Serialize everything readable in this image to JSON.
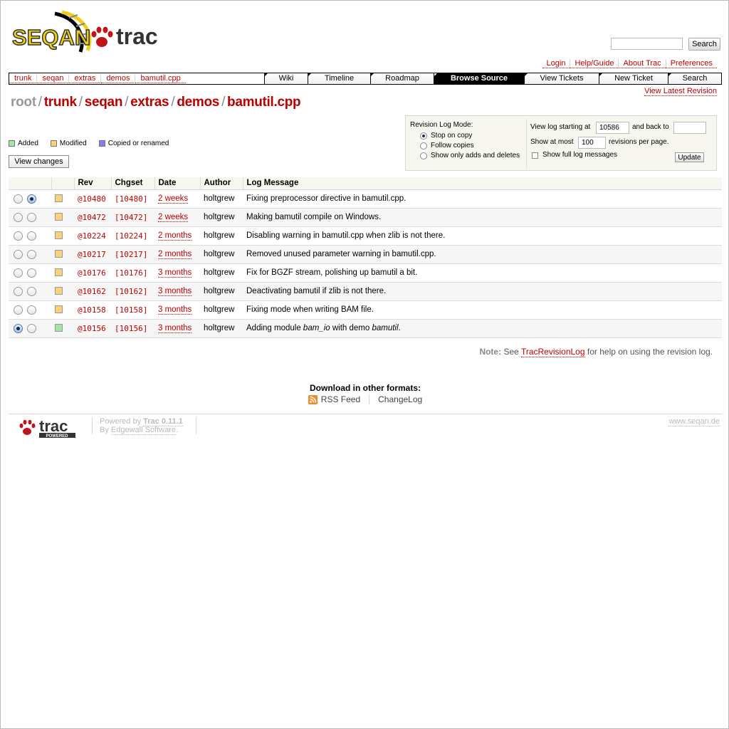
{
  "header": {
    "logo_text_seqan": "SEQAN",
    "logo_text_trac": "trac",
    "search_placeholder": "",
    "search_button": "Search"
  },
  "metanav": [
    "Login",
    "Help/Guide",
    "About Trac",
    "Preferences"
  ],
  "pathnav": [
    "trunk",
    "seqan",
    "extras",
    "demos",
    "bamutil.cpp"
  ],
  "mainnav": [
    {
      "label": "Wiki",
      "active": false
    },
    {
      "label": "Timeline",
      "active": false
    },
    {
      "label": "Roadmap",
      "active": false
    },
    {
      "label": "Browse Source",
      "active": true
    },
    {
      "label": "View Tickets",
      "active": false
    },
    {
      "label": "New Ticket",
      "active": false
    },
    {
      "label": "Search",
      "active": false
    }
  ],
  "view_latest": "View Latest Revision",
  "path_title": {
    "root": "root",
    "parts": [
      "trunk",
      "seqan",
      "extras",
      "demos",
      "bamutil.cpp"
    ],
    "separator": "/"
  },
  "legend": [
    {
      "label": "Added",
      "color": "#a3e6a3"
    },
    {
      "label": "Modified",
      "color": "#fbd27a"
    },
    {
      "label": "Copied or renamed",
      "color": "#8080f0"
    }
  ],
  "view_changes_label": "View changes",
  "prefs": {
    "mode_title": "Revision Log Mode:",
    "modes": [
      {
        "label": "Stop on copy",
        "checked": true
      },
      {
        "label": "Follow copies",
        "checked": false
      },
      {
        "label": "Show only adds and deletes",
        "checked": false
      }
    ],
    "start_label": "View log starting at",
    "start_value": "10586",
    "back_label": "and back to",
    "back_value": "",
    "show_at_most": "Show at most",
    "limit_value": "100",
    "per_page": "revisions per page.",
    "full_log_label": "Show full log messages",
    "full_log_checked": false,
    "update_label": "Update"
  },
  "table": {
    "headers": [
      "Rev",
      "Chgset",
      "Date",
      "Author",
      "Log Message"
    ],
    "rows": [
      {
        "old": false,
        "new": true,
        "change": "modified",
        "rev": "@10480",
        "chgset": "[10480]",
        "date": "2 weeks",
        "author": "holtgrew",
        "msg": "Fixing preprocessor directive in bamutil.cpp."
      },
      {
        "old": false,
        "new": false,
        "change": "modified",
        "rev": "@10472",
        "chgset": "[10472]",
        "date": "2 weeks",
        "author": "holtgrew",
        "msg": "Making bamutil compile on Windows."
      },
      {
        "old": false,
        "new": false,
        "change": "modified",
        "rev": "@10224",
        "chgset": "[10224]",
        "date": "2 months",
        "author": "holtgrew",
        "msg": "Disabling warning in bamutil.cpp when zlib is not there."
      },
      {
        "old": false,
        "new": false,
        "change": "modified",
        "rev": "@10217",
        "chgset": "[10217]",
        "date": "2 months",
        "author": "holtgrew",
        "msg": "Removed unused parameter warning in bamutil.cpp."
      },
      {
        "old": false,
        "new": false,
        "change": "modified",
        "rev": "@10176",
        "chgset": "[10176]",
        "date": "3 months",
        "author": "holtgrew",
        "msg": "Fix for BGZF stream, polishing up bamutil a bit."
      },
      {
        "old": false,
        "new": false,
        "change": "modified",
        "rev": "@10162",
        "chgset": "[10162]",
        "date": "3 months",
        "author": "holtgrew",
        "msg": "Deactivating bamutil if zlib is not there."
      },
      {
        "old": false,
        "new": false,
        "change": "modified",
        "rev": "@10158",
        "chgset": "[10158]",
        "date": "3 months",
        "author": "holtgrew",
        "msg": "Fixing mode when writing BAM file."
      },
      {
        "old": true,
        "new": false,
        "change": "added",
        "rev": "@10156",
        "chgset": "[10156]",
        "date": "3 months",
        "author": "holtgrew",
        "msg_parts": [
          "Adding module ",
          "bam_io",
          " with demo ",
          "bamutil",
          "."
        ]
      }
    ]
  },
  "note": {
    "label": "Note:",
    "pre": "See",
    "link": "TracRevisionLog",
    "post": "for help on using the revision log."
  },
  "alt_formats": {
    "title": "Download in other formats:",
    "rss": "RSS Feed",
    "changelog": "ChangeLog"
  },
  "footer": {
    "badge_trac": "trac",
    "badge_powered": "POWERED",
    "powered_by_pre": "Powered by",
    "powered_by_name": "Trac 0.11.1",
    "by_pre": "By",
    "by_link": "Edgewall Software",
    "by_post": ".",
    "site_url": "www.seqan.de"
  },
  "colors": {
    "link": "#bb0000",
    "modified": "#fbd27a",
    "added": "#a3e6a3"
  }
}
